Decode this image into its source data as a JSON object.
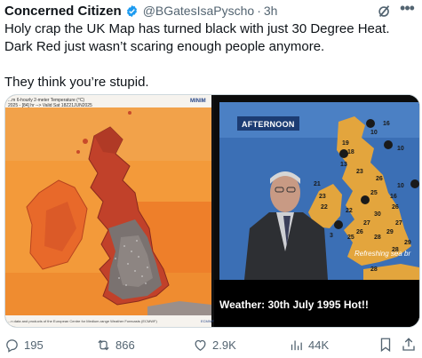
{
  "post": {
    "author_name": "Concerned Citizen",
    "handle": "@BGatesIsaPyscho",
    "separator": "·",
    "time": "3h",
    "text_lines": [
      "Holy crap the UK Map has turned black with just 30 Degree Heat.",
      "Dark Red just wasn’t scaring enough people anymore.",
      "They think you’re stupid."
    ]
  },
  "media": {
    "left_image": {
      "header_line1": "...m 6-hourly 2-meter Temperature (°C)",
      "header_line2": "2025 - [84] hr --> Valid Sat 18Z21JUN2025",
      "logo": "MINIM",
      "footer": "...n data and products of the European Centre for Medium-range Weather Forecasts (ECMWF)",
      "footer_right": "ECMWF"
    },
    "right_image": {
      "banner": "AFTERNOON",
      "overlay_text": "Refreshing sea br",
      "caption": "Weather: 30th July 1995 Hot!!",
      "map_numbers": [
        "10",
        "16",
        "19",
        "18",
        "10",
        "13",
        "23",
        "26",
        "10",
        "21",
        "23",
        "25",
        "16",
        "22",
        "22",
        "30",
        "26",
        "27",
        "27",
        "26",
        "29",
        "28",
        "25",
        "28",
        "29",
        "28",
        "3"
      ]
    }
  },
  "actions": {
    "replies": "195",
    "reposts": "866",
    "likes": "2.9K",
    "views": "44K"
  },
  "colors": {
    "text": "#0f1419",
    "secondary": "#536471",
    "verified": "#1d9bf0",
    "heat_orange": "#f08a2c",
    "heat_dark": "#6a2315"
  }
}
